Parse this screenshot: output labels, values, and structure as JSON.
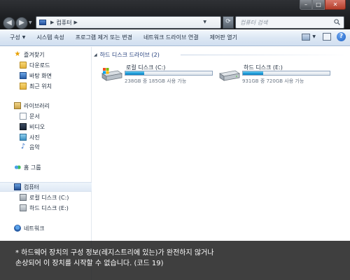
{
  "titlebar": {
    "controls": {
      "minimize": "–",
      "maximize": "□",
      "close": "✕"
    }
  },
  "nav": {
    "back_icon": "back-arrow-icon",
    "forward_icon": "forward-arrow-icon",
    "back_glyph": "◀",
    "forward_glyph": "▶",
    "history_glyph": "▼"
  },
  "address": {
    "path": "컴퓨터",
    "separator": "▶",
    "dropdown_glyph": "▼",
    "refresh_glyph": "⟳"
  },
  "search": {
    "placeholder": "컴퓨터 검색"
  },
  "toolbar": {
    "items": [
      {
        "label": "구성",
        "caret": "▼"
      },
      {
        "label": "시스템 속성"
      },
      {
        "label": "프로그램 제거 또는 변경"
      },
      {
        "label": "네트워크 드라이브 연결"
      },
      {
        "label": "제어판 열기"
      }
    ],
    "view_caret": "▼",
    "help_label": "?"
  },
  "sidebar": {
    "favorites": {
      "label": "즐겨찾기",
      "icon": "star-icon",
      "glyph": "★"
    },
    "favorite_items": [
      {
        "label": "다운로드",
        "icon": "downloads-folder-icon"
      },
      {
        "label": "바탕 화면",
        "icon": "desktop-icon"
      },
      {
        "label": "최근 위치",
        "icon": "recent-places-icon"
      }
    ],
    "libraries": {
      "label": "라이브러리",
      "icon": "library-icon"
    },
    "library_items": [
      {
        "label": "문서",
        "icon": "documents-icon"
      },
      {
        "label": "비디오",
        "icon": "videos-icon"
      },
      {
        "label": "사진",
        "icon": "pictures-icon"
      },
      {
        "label": "음악",
        "icon": "music-icon",
        "glyph": "♪"
      }
    ],
    "homegroup": {
      "label": "홈 그룹",
      "icon": "homegroup-icon"
    },
    "computer": {
      "label": "컴퓨터",
      "icon": "computer-icon"
    },
    "computer_items": [
      {
        "label": "로컬 디스크 (C:)",
        "icon": "local-disk-icon"
      },
      {
        "label": "하드 디스크 (E:)",
        "icon": "hard-disk-icon"
      }
    ],
    "network": {
      "label": "네트워크",
      "icon": "network-icon"
    }
  },
  "content": {
    "group_title": "하드 디스크 드라이브 (2)",
    "group_toggle": "◢",
    "drives": [
      {
        "name": "로컬 디스크 (C:)",
        "info": "238GB 중 185GB 사용 가능",
        "used_fraction": 0.22,
        "icon": "windows-drive-icon"
      },
      {
        "name": "하드 디스크 (E:)",
        "info": "931GB 중 720GB 사용 가능",
        "used_fraction": 0.23,
        "icon": "hard-drive-icon"
      }
    ]
  },
  "caption": {
    "line1": "* 하드웨어 장치의 구성 정보(레지스트리에 있는)가 완전하지 않거나",
    "line2": "손상되어 이 장치를 시작할 수 없습니다. (코드 19)"
  }
}
